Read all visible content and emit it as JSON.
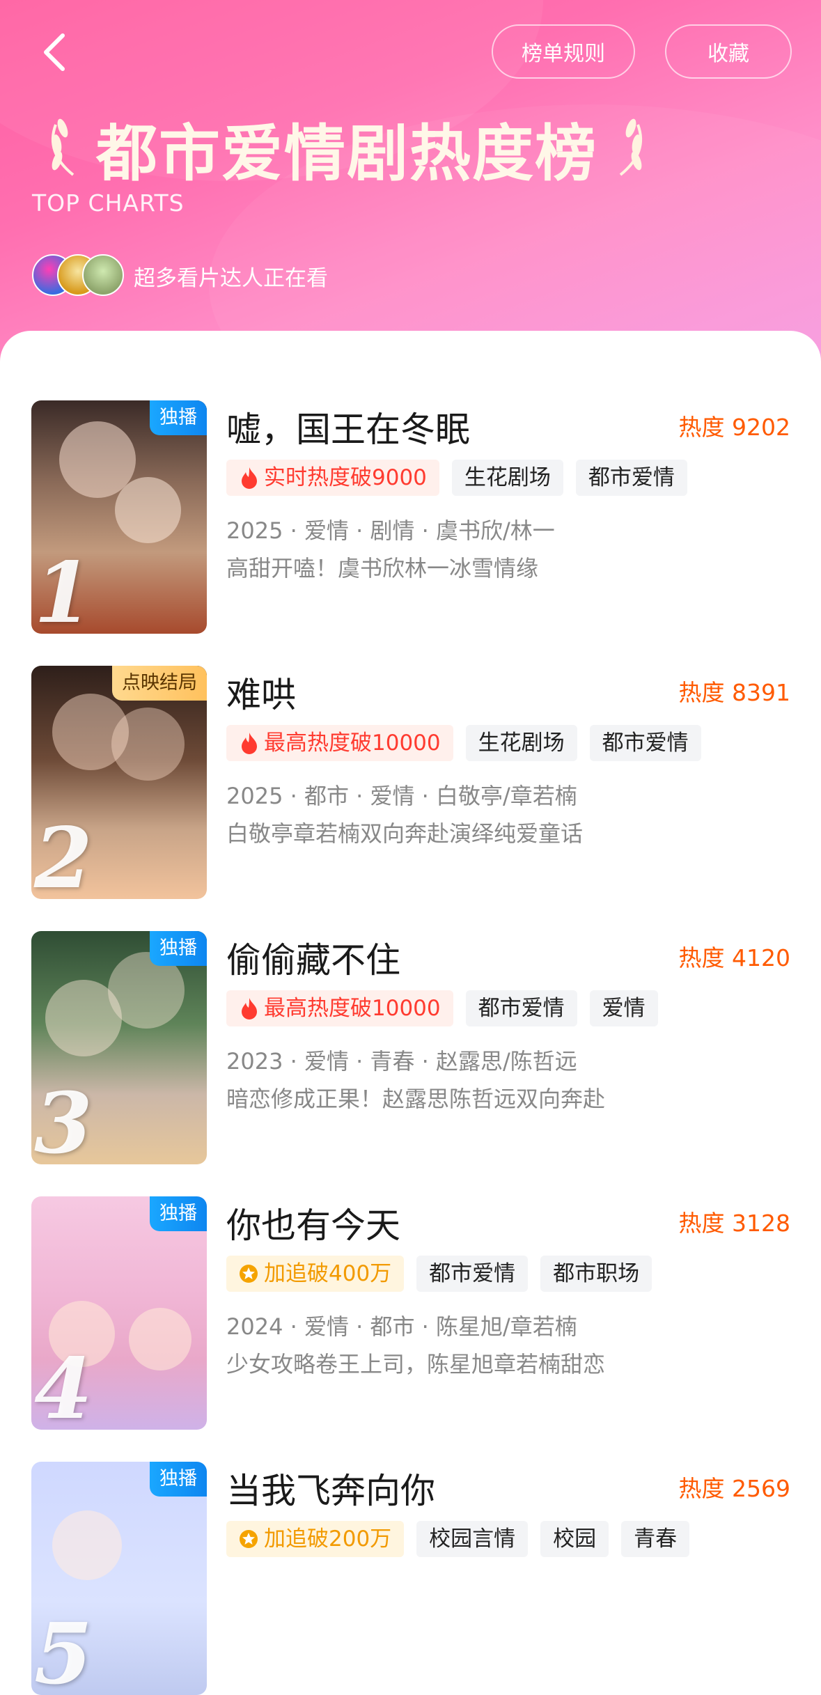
{
  "header": {
    "rules_label": "榜单规则",
    "favorite_label": "收藏",
    "title": "都市爱情剧热度榜",
    "subtitle": "TOP CHARTS",
    "watching_text": "超多看片达人正在看"
  },
  "colors": {
    "accent_pink": "#ff5fa1",
    "heat_orange": "#ff5a00",
    "badge_blue": "#1aa7ff"
  },
  "items": [
    {
      "rank": "1",
      "badge": "独播",
      "badge_style": "blue",
      "name": "嘘，国王在冬眠",
      "heat": "热度 9202",
      "tags": [
        "实时热度破9000",
        "生花剧场",
        "都市爱情"
      ],
      "meta": "2025 · 爱情 · 剧情 · 虞书欣/林一",
      "desc": "高甜开嗑！虞书欣林一冰雪情缘"
    },
    {
      "rank": "2",
      "badge": "点映结局",
      "badge_style": "gold",
      "name": "难哄",
      "heat": "热度 8391",
      "tags": [
        "最高热度破10000",
        "生花剧场",
        "都市爱情"
      ],
      "meta": "2025 · 都市 · 爱情 · 白敬亭/章若楠",
      "desc": "白敬亭章若楠双向奔赴演绎纯爱童话"
    },
    {
      "rank": "3",
      "badge": "独播",
      "badge_style": "blue",
      "name": "偷偷藏不住",
      "heat": "热度 4120",
      "tags": [
        "最高热度破10000",
        "都市爱情",
        "爱情"
      ],
      "meta": "2023 · 爱情 · 青春 · 赵露思/陈哲远",
      "desc": "暗恋修成正果！赵露思陈哲远双向奔赴"
    },
    {
      "rank": "4",
      "badge": "独播",
      "badge_style": "blue",
      "name": "你也有今天",
      "heat": "热度 3128",
      "tags": [
        "加追破400万",
        "都市爱情",
        "都市职场"
      ],
      "meta": "2024 · 爱情 · 都市 · 陈星旭/章若楠",
      "desc": "少女攻略卷王上司，陈星旭章若楠甜恋"
    },
    {
      "rank": "5",
      "badge": "独播",
      "badge_style": "blue",
      "name": "当我飞奔向你",
      "heat": "热度 2569",
      "tags": [
        "加追破200万",
        "校园言情",
        "校园",
        "青春"
      ]
    }
  ]
}
